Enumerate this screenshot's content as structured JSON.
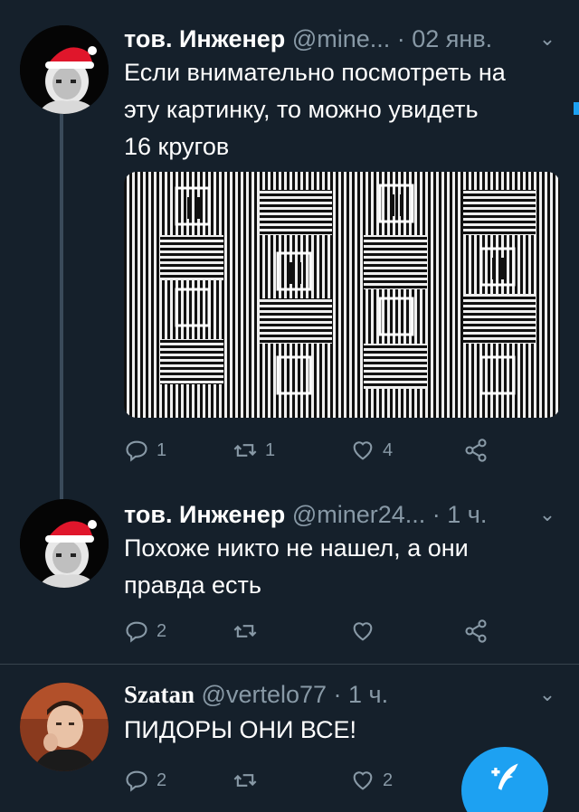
{
  "tweets": [
    {
      "name": "тов. Инженер",
      "handle": "@mine...",
      "time": "· 02 янв.",
      "text_lines": [
        "Если внимательно посмотреть на",
        "эту картинку, то можно увидеть",
        "16 кругов"
      ],
      "avatar": "user-avatar-santa-hat",
      "replies": "1",
      "retweets": "1",
      "likes": "4"
    },
    {
      "name": "тов. Инженер",
      "handle": "@miner24...",
      "time": "· 1 ч.",
      "text_lines": [
        "Похоже никто не нашел, а они",
        "правда есть"
      ],
      "avatar": "user-avatar-santa-hat",
      "replies": "2",
      "retweets": "",
      "likes": ""
    },
    {
      "name": "Szatan",
      "handle": "@vertelo77",
      "time": "· 1 ч.",
      "text_lines": [
        "ПИДОРЫ ОНИ ВСЕ!"
      ],
      "avatar": "user-avatar-young-man",
      "replies": "2",
      "retweets": "",
      "likes": "2"
    }
  ],
  "media": {
    "description_icon": "optical-illusion-image"
  },
  "icons": {
    "reply": "reply-icon",
    "retweet": "retweet-icon",
    "like": "heart-icon",
    "share": "share-icon",
    "menu": "chevron-down-icon",
    "compose": "compose-tweet-icon"
  },
  "colors": {
    "background": "#15202b",
    "accent": "#1da1f2",
    "secondary_text": "#8899a6"
  }
}
